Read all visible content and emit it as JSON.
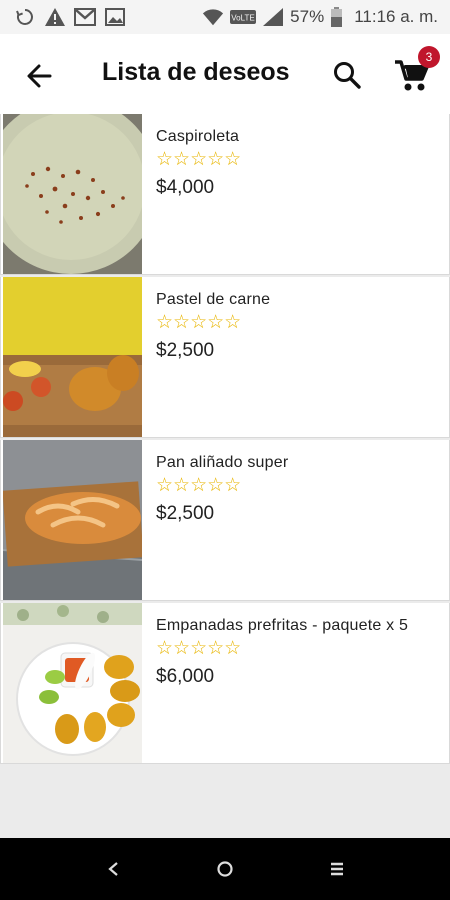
{
  "status_bar": {
    "battery": "57%",
    "time": "11:16 a. m.",
    "network_label": "VoLTE"
  },
  "header": {
    "title": "Lista de deseos",
    "cart_count": "3"
  },
  "products": [
    {
      "name": "Caspiroleta",
      "rating": 0,
      "stars": "☆☆☆☆☆",
      "price": "$4,000"
    },
    {
      "name": "Pastel de carne",
      "rating": 0,
      "stars": "☆☆☆☆☆",
      "price": "$2,500"
    },
    {
      "name": "Pan aliñado super",
      "rating": 0,
      "stars": "☆☆☆☆☆",
      "price": "$2,500"
    },
    {
      "name": "Empanadas prefritas - paquete x 5",
      "rating": 0,
      "stars": "☆☆☆☆☆",
      "price": "$6,000"
    }
  ],
  "colors": {
    "accent_badge": "#c0162c",
    "star": "#e8b500",
    "nav_bar": "#000000"
  },
  "icons": {
    "back": "arrow-left-icon",
    "search": "search-icon",
    "cart": "cart-icon",
    "nav_back": "nav-back-icon",
    "nav_home": "nav-home-icon",
    "nav_recents": "nav-recents-icon"
  }
}
